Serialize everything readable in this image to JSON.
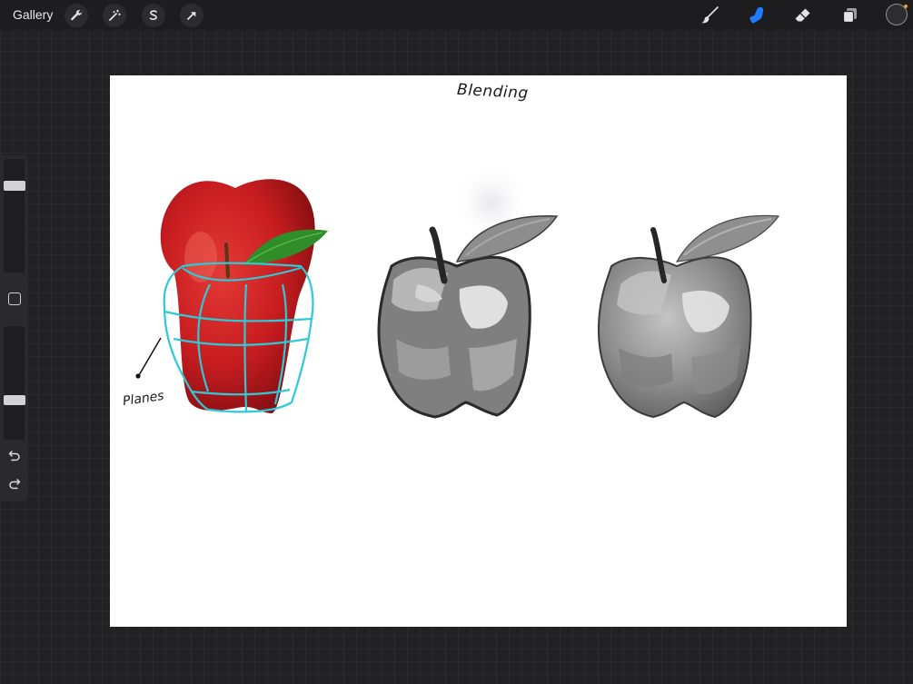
{
  "toolbar": {
    "gallery_label": "Gallery",
    "left_tools": [
      "wrench-icon",
      "magic-wand-icon",
      "selection-icon",
      "transform-arrow-icon"
    ],
    "right_tools": [
      "brush-icon",
      "smudge-icon",
      "eraser-icon",
      "layers-icon"
    ],
    "active_tool": "smudge",
    "accent_color": "#1f7cff",
    "current_color": "#2d2d2f"
  },
  "sidebar": {
    "brush_size": 0.8,
    "opacity": 0.6,
    "buttons": [
      "modify-square-icon",
      "undo-icon",
      "redo-icon"
    ]
  },
  "canvas": {
    "background": "#ffffff",
    "title_text": "Blending",
    "planes_label": "Planes",
    "plane_line_color": "#2ec9d6",
    "apple_red": "#c81d20",
    "leaf_green": "#2f8d2a"
  }
}
